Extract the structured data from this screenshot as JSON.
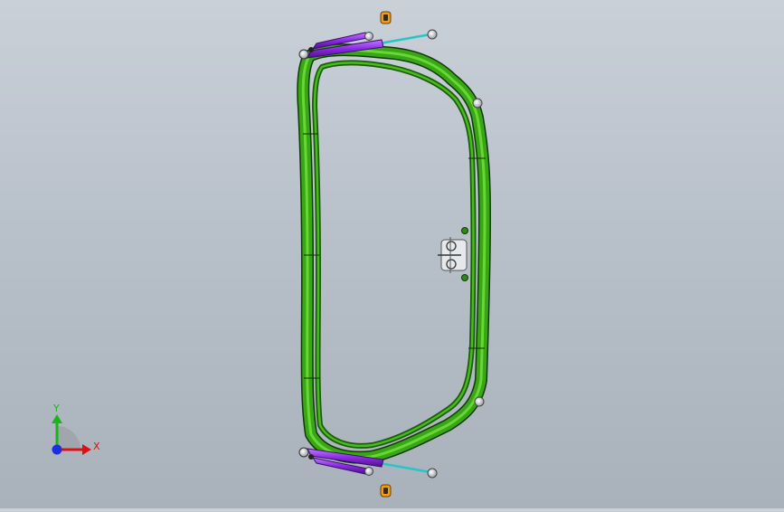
{
  "viewport": {
    "background_top": "#c9d0d8",
    "background_bottom": "#a9b1bb"
  },
  "model": {
    "frame_color": "#2e8a16",
    "frame_highlight": "#4cc41c",
    "frame_edge": "#0f3a05",
    "strut_color": "#8a2be2",
    "rod_color": "#27c6c6",
    "fitting_color": "#f39c12",
    "hardware_color": "#cfd4d8"
  },
  "triad": {
    "y_label": "Y",
    "x_label": "X",
    "y_color": "#1db31d",
    "x_color": "#e01010",
    "z_color": "#1c2ee0"
  }
}
